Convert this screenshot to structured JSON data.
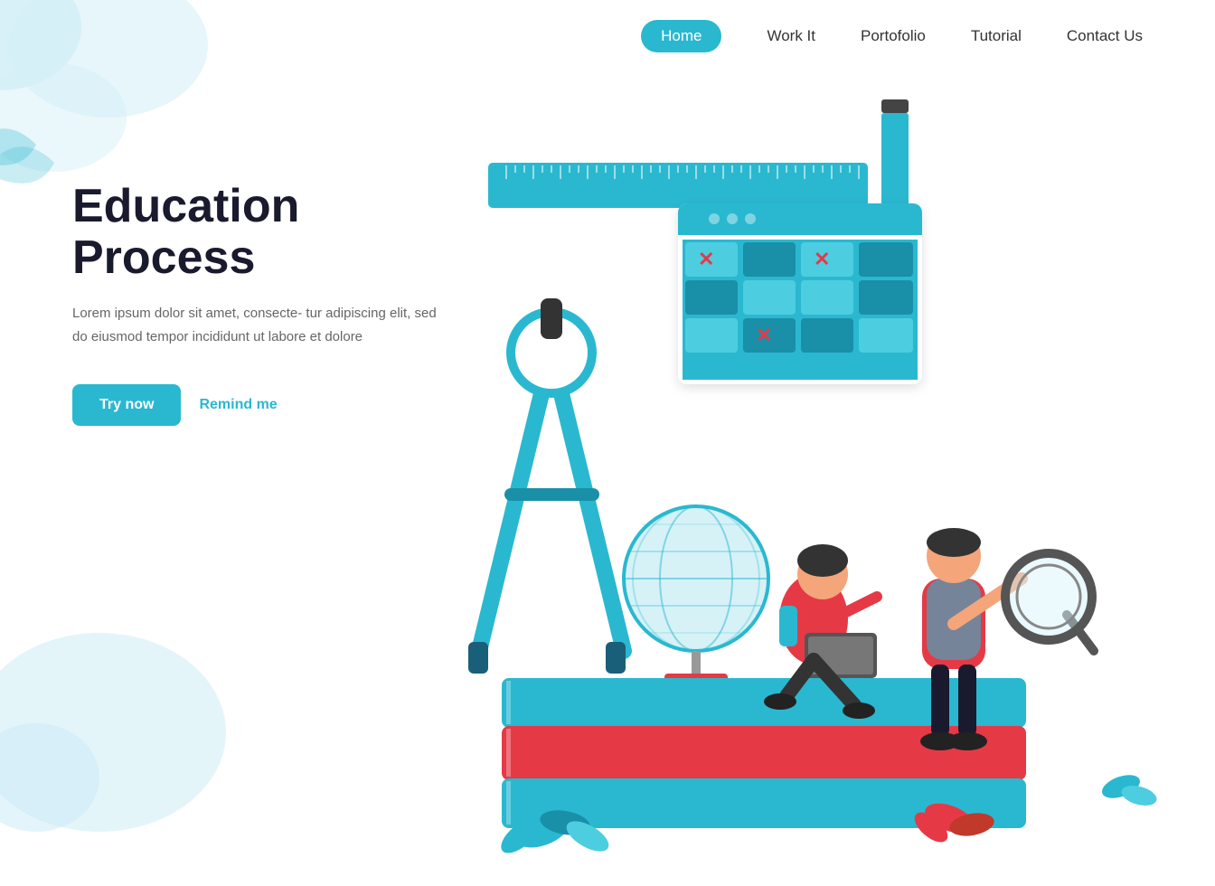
{
  "nav": {
    "items": [
      {
        "label": "Home",
        "active": true
      },
      {
        "label": "Work It",
        "active": false
      },
      {
        "label": "Portofolio",
        "active": false
      },
      {
        "label": "Tutorial",
        "active": false
      },
      {
        "label": "Contact Us",
        "active": false
      }
    ]
  },
  "hero": {
    "title": "Education Process",
    "subtitle": "Lorem ipsum dolor sit amet, consecte-\ntur adipiscing elit, sed do eiusmod\ntempor incididunt ut labore et dolore",
    "btn_primary": "Try now",
    "btn_secondary": "Remind me"
  },
  "colors": {
    "accent": "#2ab8d0",
    "red": "#e63946",
    "dark": "#1a1a2e",
    "blob": "#d6f0f7"
  }
}
